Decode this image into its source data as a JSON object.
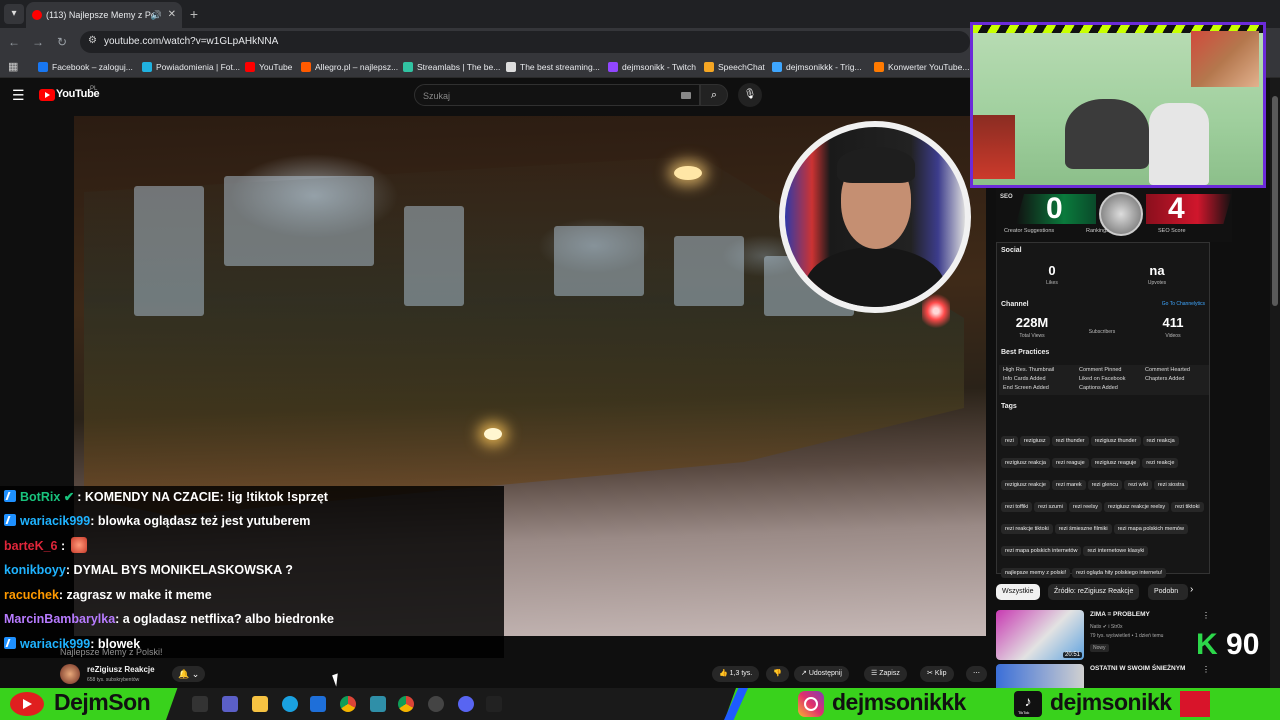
{
  "browser": {
    "tab_title": "(113) Najlepsze Memy z Po",
    "url": "youtube.com/watch?v=w1GLpAHkNNA",
    "bookmarks": [
      {
        "label": "Facebook – zaloguj...",
        "color": "#1877f2"
      },
      {
        "label": "Powiadomienia | Fot...",
        "color": "#20b2e0"
      },
      {
        "label": "YouTube",
        "color": "#ff0000"
      },
      {
        "label": "Allegro.pl – najlepsz...",
        "color": "#ff5a00"
      },
      {
        "label": "Streamlabs | The be...",
        "color": "#31c3a2"
      },
      {
        "label": "The best streaming...",
        "color": "#dddddd"
      },
      {
        "label": "dejmsonikk - Twitch",
        "color": "#9146ff"
      },
      {
        "label": "SpeechChat",
        "color": "#f5a623"
      },
      {
        "label": "dejmsonikkk - Trig...",
        "color": "#3ea6ff"
      },
      {
        "label": "Konwerter YouTube...",
        "color": "#ff7a00"
      }
    ]
  },
  "youtube": {
    "logo_text": "YouTube",
    "region": "PL",
    "search_placeholder": "Szukaj"
  },
  "chat": [
    {
      "user": "BotRix",
      "color": "#19c37d",
      "verified": true,
      "message": ": KOMENDY NA CZACIE: !ig !tiktok !sprzęt",
      "badge": true
    },
    {
      "user": "wariacik999",
      "color": "#1fb3ff",
      "message": ": blowka oglądasz też jest yutuberem",
      "badge": true
    },
    {
      "user": "barteK_6",
      "color": "#e0263a",
      "message": " :",
      "emote": true,
      "badge": false
    },
    {
      "user": "konikboyy",
      "color": "#1fb3ff",
      "message": ": DYMAL BYS MONIKELASKOWSKA ?",
      "badge": false
    },
    {
      "user": "racuchek",
      "color": "#ff9a00",
      "message": ": zagrasz w make it meme",
      "badge": false
    },
    {
      "user": "MarcinBambarylka",
      "color": "#b77bff",
      "message": ": a ogladasz netflixa? albo biedronke",
      "badge": false
    },
    {
      "user": "wariacik999",
      "color": "#1fb3ff",
      "message": ": blowek",
      "badge": true
    }
  ],
  "video_title_overlay": "Najlepsze Memy z Polski!",
  "channel": {
    "name": "reZigiusz Reakcje",
    "subs": "658 tys. subskrybentów"
  },
  "actions": {
    "likes": "1,3 tys.",
    "share": "Udostępnij",
    "save": "Zapisz",
    "clip": "Klip"
  },
  "seo_panel": {
    "seo_label": "SEO",
    "score_left": "0",
    "score_right": "4",
    "caption_left": "Creator Suggestions",
    "caption_mid": "Rankings",
    "caption_right": "SEO Score",
    "social_title": "Social",
    "likes_value": "0",
    "likes_label": "Likes",
    "upvotes_value": "na",
    "upvotes_label": "Upvotes",
    "channel_title": "Channel",
    "channel_link": "Go To Channelytics",
    "views_value": "228M",
    "views_label": "Total Views",
    "subs_label": "Subscribers",
    "videos_value": "411",
    "videos_label": "Videos",
    "bp_title": "Best Practices",
    "bp_items": [
      "High Res. Thumbnail",
      "Info Cards Added",
      "End Screen Added",
      "Comment Pinned",
      "Liked on Facebook",
      "Captions Added",
      "Comment Hearted",
      "Chapters Added"
    ],
    "tags_title": "Tags",
    "tags": [
      "rezi",
      "rezigiusz",
      "rezi thunder",
      "rezigiusz thunder",
      "rezi reakcja",
      "rezigiusz reakcja",
      "rezi reaguje",
      "rezigiusz reaguje",
      "rezi reakcje",
      "rezigiusz reakcje",
      "rezi marek",
      "rezi glencu",
      "rezi wiki",
      "rezi siostra",
      "rezi toffiki",
      "rezi szumi",
      "rezi reelsy",
      "rezigiusz reakcje reelsy",
      "rezi tiktoki",
      "rezi reakcje tiktoki",
      "rezi śmieszne filmiki",
      "rezi mapa polskich memów",
      "rezi mapa polskich internetów",
      "rezi internetowe klasyki",
      "najlepsze memy z polski!",
      "rezi ogląda hity polskiego internetu!"
    ]
  },
  "chips": [
    "Wszystkie",
    "Źródło: reZigiusz Reakcje",
    "Podobn"
  ],
  "recommendation": {
    "title": "ZIMA = PROBLEMY",
    "channel": "Natix ✔ i Str0x",
    "meta": "79 tys. wyświetleń • 1 dzień temu",
    "badge": "Nowy",
    "duration": "20:51",
    "title2": "OSTATNI W SWOIM ŚNIEŻNYM"
  },
  "overlay_counter": {
    "letter": "K",
    "value": "90"
  },
  "streambar": {
    "name": "DejmSon",
    "instagram": "dejmsonikkk",
    "tiktok": "dejmsonikk",
    "tiktok_caption": "TikTok"
  }
}
